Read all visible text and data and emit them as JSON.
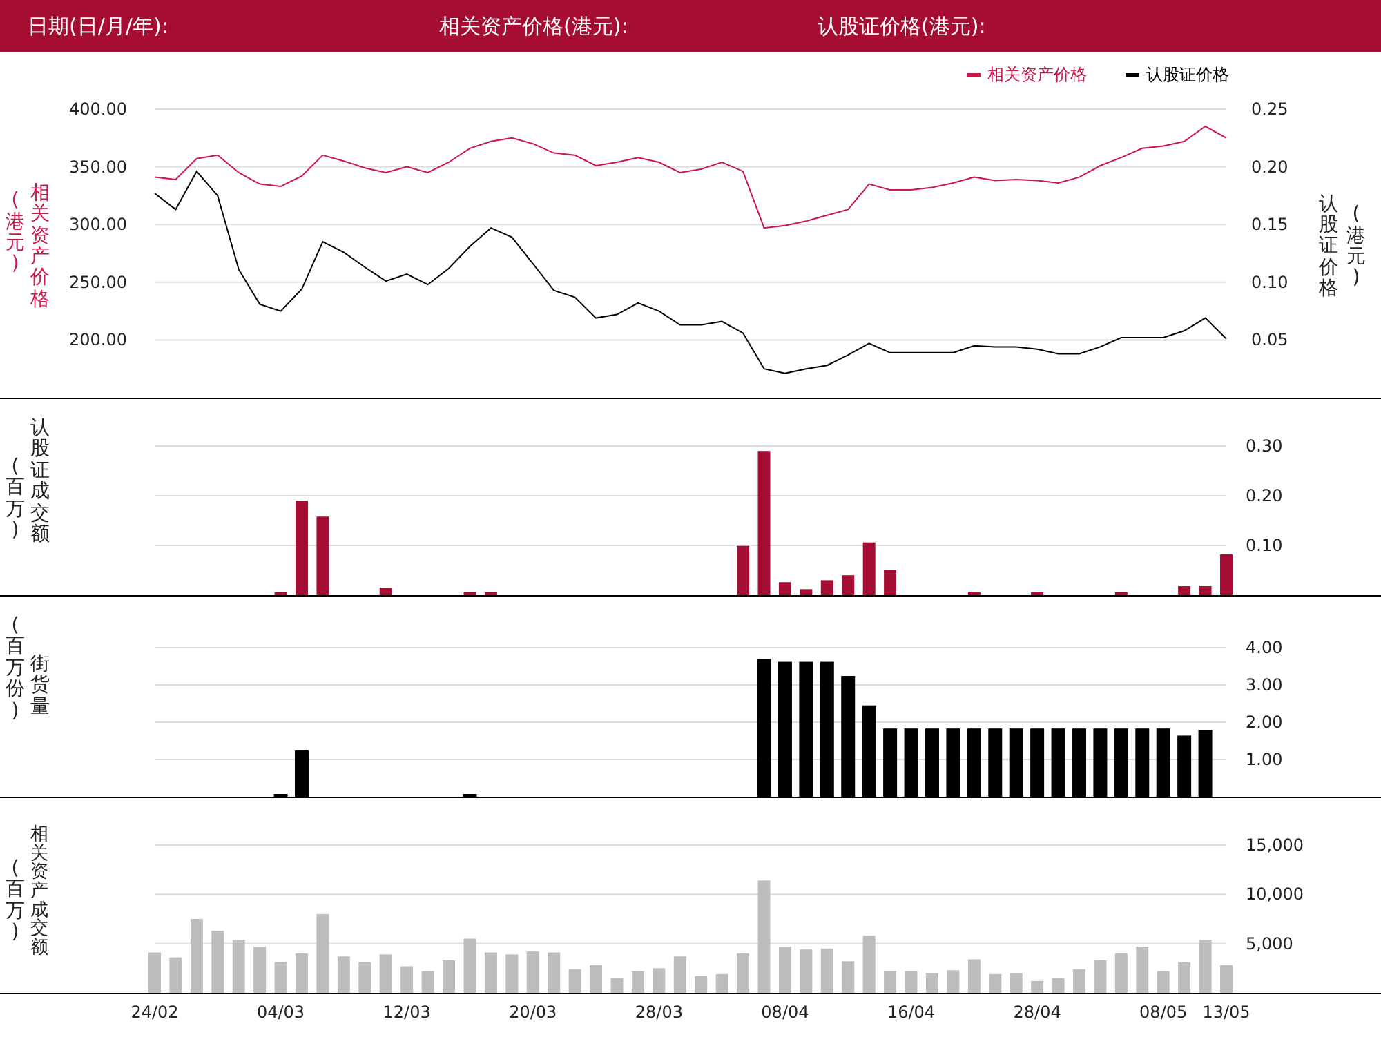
{
  "header": {
    "fields": [
      {
        "label": "日期(日/月/年):"
      },
      {
        "label": "相关资产价格(港元):"
      },
      {
        "label": "认股证价格(港元):"
      }
    ]
  },
  "price_chart": {
    "left_unit": "(港元)",
    "right_unit": "(港元)",
    "chart_data": {
      "type": "line",
      "grid": true,
      "legend": true,
      "ylim": [
        150,
        400
      ],
      "y2lim": [
        0,
        0.25
      ],
      "yticks": [
        {
          "value": 200,
          "label": "200.00"
        },
        {
          "value": 250,
          "label": "250.00"
        },
        {
          "value": 300,
          "label": "300.00"
        },
        {
          "value": 350,
          "label": "350.00"
        },
        {
          "value": 400,
          "label": "400.00"
        }
      ],
      "y2ticks": [
        {
          "value": 0.05,
          "label": "0.05"
        },
        {
          "value": 0.1,
          "label": "0.10"
        },
        {
          "value": 0.15,
          "label": "0.15"
        },
        {
          "value": 0.2,
          "label": "0.20"
        },
        {
          "value": 0.25,
          "label": "0.25"
        }
      ],
      "series": [
        {
          "name": "相关资产价格",
          "color": "#c8194a",
          "values": [
            341,
            339,
            357,
            360,
            345,
            335,
            333,
            342,
            360,
            355,
            349,
            345,
            350,
            345,
            354,
            366,
            372,
            375,
            370,
            362,
            360,
            351,
            354,
            358,
            354,
            345,
            348,
            354,
            346,
            297,
            299,
            303,
            308,
            313,
            335,
            330,
            330,
            332,
            336,
            341,
            338,
            339,
            338,
            336,
            341,
            351,
            358,
            366,
            368,
            372,
            385,
            375
          ]
        },
        {
          "name": "认股证价格",
          "color": "#000000",
          "axis": "y2",
          "values": [
            0.177,
            0.163,
            0.196,
            0.175,
            0.111,
            0.081,
            0.075,
            0.094,
            0.135,
            0.126,
            0.113,
            0.101,
            0.107,
            0.098,
            0.112,
            0.131,
            0.147,
            0.139,
            0.116,
            0.093,
            0.087,
            0.069,
            0.072,
            0.082,
            0.075,
            0.063,
            0.063,
            0.066,
            0.056,
            0.025,
            0.021,
            0.025,
            0.028,
            0.037,
            0.047,
            0.039,
            0.039,
            0.039,
            0.039,
            0.045,
            0.044,
            0.044,
            0.042,
            0.038,
            0.038,
            0.044,
            0.052,
            0.052,
            0.052,
            0.058,
            0.069,
            0.051
          ]
        }
      ]
    }
  },
  "warrant_turnover_chart": {
    "unit": "(百万)",
    "chart_data": {
      "type": "bar",
      "grid": true,
      "ylim": [
        0,
        0.3
      ],
      "yticks": [
        {
          "value": 0.1,
          "label": "0.10"
        },
        {
          "value": 0.2,
          "label": "0.20"
        },
        {
          "value": 0.3,
          "label": "0.30"
        }
      ],
      "series": [
        {
          "name": "认股证成交额",
          "color": "#a50d32",
          "values": [
            0,
            0,
            0,
            0,
            0,
            0,
            0.003,
            0.19,
            0.158,
            0,
            0,
            0.015,
            0,
            0,
            0,
            0.003,
            0.003,
            0,
            0,
            0,
            0,
            0,
            0,
            0,
            0,
            0,
            0,
            0,
            0.099,
            0.29,
            0.026,
            0.012,
            0.03,
            0.04,
            0.106,
            0.05,
            0,
            0,
            0,
            0.006,
            0,
            0,
            0.006,
            0,
            0,
            0,
            0.003,
            0,
            0,
            0.018,
            0.018,
            0.082
          ]
        }
      ]
    }
  },
  "outstanding_chart": {
    "unit": "(百万份)",
    "chart_data": {
      "type": "bar",
      "grid": true,
      "ylim": [
        0,
        4
      ],
      "yticks": [
        {
          "value": 1,
          "label": "1.00"
        },
        {
          "value": 2,
          "label": "2.00"
        },
        {
          "value": 3,
          "label": "3.00"
        },
        {
          "value": 4,
          "label": "4.00"
        }
      ],
      "series": [
        {
          "name": "街货量",
          "color": "#000000",
          "values": [
            0,
            0,
            0,
            0,
            0,
            0,
            0.03,
            1.24,
            0,
            0,
            0,
            0,
            0,
            0,
            0,
            0.03,
            0,
            0,
            0,
            0,
            0,
            0,
            0,
            0,
            0,
            0,
            0,
            0,
            0,
            3.69,
            3.62,
            3.62,
            3.62,
            3.24,
            2.45,
            1.83,
            1.83,
            1.83,
            1.83,
            1.83,
            1.83,
            1.83,
            1.83,
            1.83,
            1.83,
            1.83,
            1.83,
            1.83,
            1.83,
            1.64,
            1.79,
            0
          ]
        }
      ]
    }
  },
  "underlying_turnover_chart": {
    "unit": "(百万)",
    "chart_data": {
      "type": "bar",
      "grid": true,
      "ylim": [
        0,
        15000
      ],
      "yticks": [
        {
          "value": 5000,
          "label": "5,000"
        },
        {
          "value": 10000,
          "label": "10,000"
        },
        {
          "value": 15000,
          "label": "15,000"
        }
      ],
      "categories": [
        "24/02",
        null,
        null,
        null,
        null,
        null,
        "04/03",
        null,
        null,
        null,
        null,
        null,
        "12/03",
        null,
        null,
        null,
        null,
        null,
        "20/03",
        null,
        null,
        null,
        null,
        null,
        "28/03",
        null,
        null,
        null,
        null,
        null,
        "08/04",
        null,
        null,
        null,
        null,
        null,
        "16/04",
        null,
        null,
        null,
        null,
        null,
        "28/04",
        null,
        null,
        null,
        null,
        null,
        "08/05",
        null,
        null,
        "13/05"
      ],
      "series": [
        {
          "name": "相关资产成交额",
          "color": "#bdbdbd",
          "values": [
            4100,
            3600,
            7500,
            6300,
            5400,
            4700,
            3100,
            4000,
            8000,
            3700,
            3100,
            3900,
            2700,
            2200,
            3300,
            5500,
            4100,
            3900,
            4200,
            4100,
            2400,
            2800,
            1500,
            2200,
            2500,
            3700,
            1700,
            1900,
            4000,
            11400,
            4700,
            4400,
            4500,
            3200,
            5800,
            2200,
            2200,
            2000,
            2300,
            3400,
            1900,
            2000,
            1200,
            1500,
            2400,
            3300,
            4000,
            4700,
            2200,
            3100,
            5400,
            2800
          ]
        }
      ]
    }
  }
}
